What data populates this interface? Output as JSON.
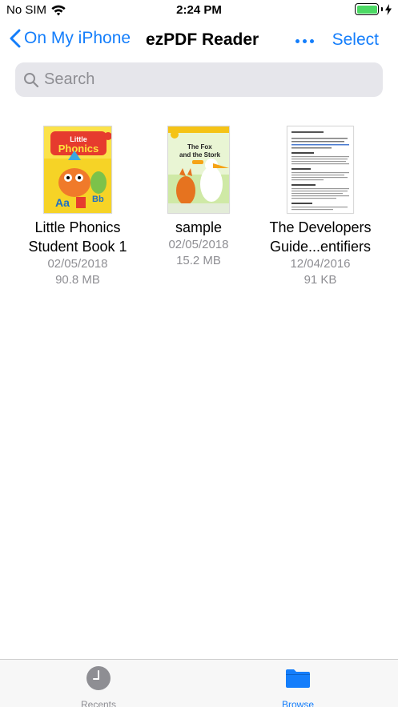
{
  "status_bar": {
    "carrier": "No SIM",
    "time": "2:24 PM",
    "battery_color": "#4cd964"
  },
  "nav": {
    "back_label": "On My iPhone",
    "title": "ezPDF Reader",
    "more_icon": "ellipsis-icon",
    "select_label": "Select"
  },
  "search": {
    "placeholder": "Search"
  },
  "files": [
    {
      "name_line1": "Little Phonics",
      "name_line2": "Student Book 1",
      "date": "02/05/2018",
      "size": "90.8 MB",
      "cover_title": "Little Phonics"
    },
    {
      "name_line1": "sample",
      "date": "02/05/2018",
      "size": "15.2 MB",
      "cover_title_1": "The Fox",
      "cover_title_2": "and the Stork"
    },
    {
      "name_line1": "The Developers",
      "name_line2": "Guide...entifiers",
      "date": "12/04/2016",
      "size": "91 KB"
    }
  ],
  "tab_bar": {
    "items": [
      {
        "label": "Recents",
        "icon": "clock-icon",
        "active": false
      },
      {
        "label": "Browse",
        "icon": "folder-icon",
        "active": true
      }
    ]
  },
  "colors": {
    "accent": "#147efb",
    "secondary_text": "#8e8e93"
  }
}
